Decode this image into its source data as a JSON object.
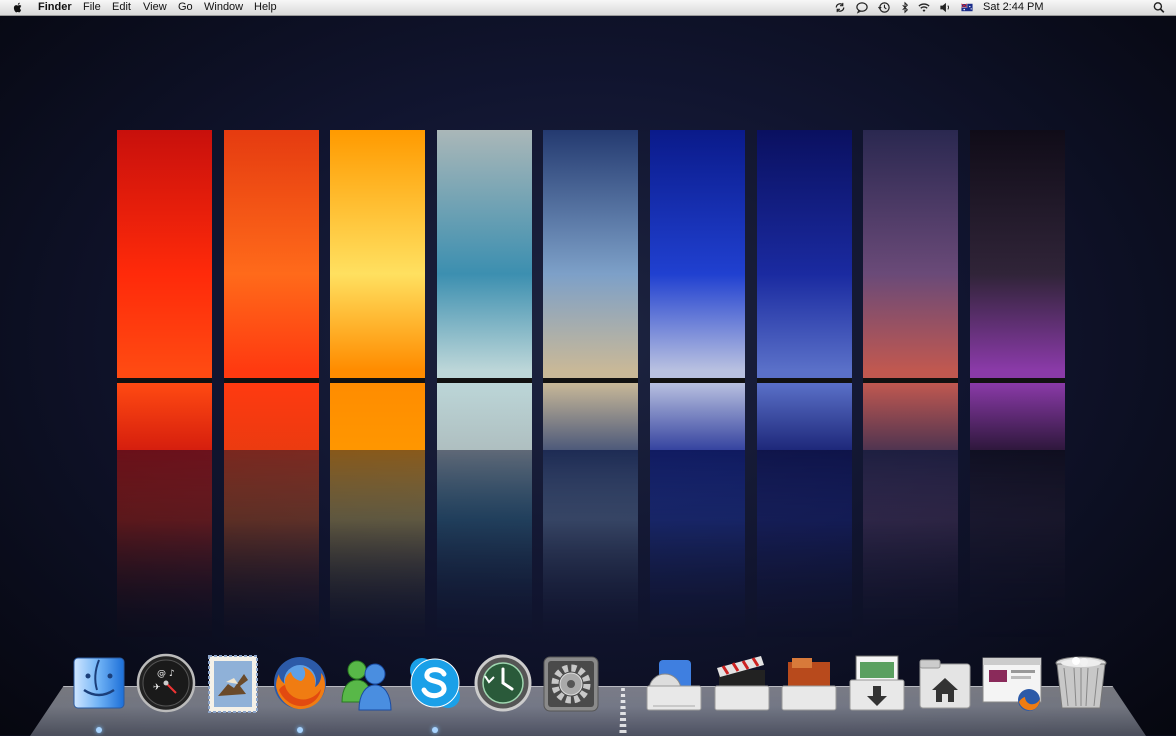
{
  "menubar": {
    "app_name": "Finder",
    "menus": [
      "File",
      "Edit",
      "View",
      "Go",
      "Window",
      "Help"
    ],
    "clock": "Sat 2:44 PM",
    "status_icons": [
      "sync-icon",
      "chat-bubble-icon",
      "time-machine-icon",
      "bluetooth-icon",
      "wifi-icon",
      "volume-icon",
      "input-flag-icon"
    ]
  },
  "desktop": {
    "wallpaper_panels": [
      "red-sunset",
      "orange-sunset",
      "yellow-sunset",
      "cyan-coast",
      "blue-clouds",
      "deep-blue",
      "navy-mountain",
      "purple-dusk",
      "violet-night"
    ],
    "panel_colors": [
      [
        "#c8100c",
        "#ff2a0a",
        "#ff4a12"
      ],
      [
        "#e53b10",
        "#ff6a1a",
        "#ff3a10"
      ],
      [
        "#ff9a00",
        "#ffe060",
        "#ff8c00"
      ],
      [
        "#aab7b8",
        "#3c8fb0",
        "#bcd6d8"
      ],
      [
        "#243a70",
        "#7da0c8",
        "#c8b898"
      ],
      [
        "#0a1a8a",
        "#2040d0",
        "#b8c0e0"
      ],
      [
        "#0a1060",
        "#1a2aa0",
        "#5a70c8"
      ],
      [
        "#2a2850",
        "#6a4a78",
        "#c05850"
      ],
      [
        "#100c18",
        "#302438",
        "#8a3aa8"
      ]
    ]
  },
  "dock": {
    "items": [
      "Finder",
      "Dashboard",
      "Mail",
      "Firefox",
      "Windows Live Messenger",
      "Skype",
      "Time Machine",
      "System Preferences",
      "Applications",
      "Movies",
      "Documents",
      "Downloads",
      "Home",
      "Firefox Downloads",
      "Trash"
    ]
  },
  "colors": {
    "menubar_bg": "#e8e8e8",
    "accent_blue": "#3a7bd5",
    "desktop_bg": "#111530"
  }
}
